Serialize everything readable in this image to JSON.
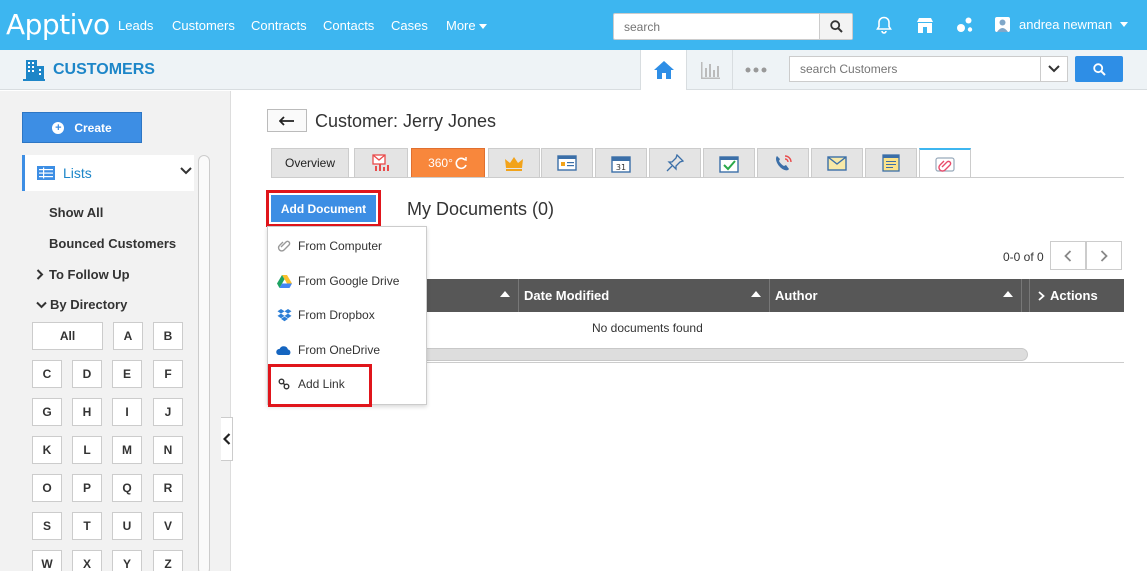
{
  "topnav": {
    "logo": "Apptivo",
    "items": [
      "Leads",
      "Customers",
      "Contracts",
      "Contacts",
      "Cases"
    ],
    "more_label": "More",
    "search_placeholder": "search",
    "user_name": "andrea newman"
  },
  "subheader": {
    "module_title": "CUSTOMERS",
    "search_placeholder": "search Customers"
  },
  "sidebar": {
    "create_label": "Create",
    "lists_label": "Lists",
    "items": [
      "Show All",
      "Bounced Customers"
    ],
    "follow_up_label": "To Follow Up",
    "by_directory_label": "By Directory",
    "alphabet": [
      "All",
      "A",
      "B",
      "C",
      "D",
      "E",
      "F",
      "G",
      "H",
      "I",
      "J",
      "K",
      "L",
      "M",
      "N",
      "O",
      "P",
      "Q",
      "R",
      "S",
      "T",
      "U",
      "V",
      "W",
      "X",
      "Y",
      "Z"
    ]
  },
  "main": {
    "title": "Customer: Jerry Jones",
    "tabs": {
      "overview": "Overview",
      "t360": "360°"
    },
    "add_document_label": "Add Document",
    "section_title": "My Documents (0)",
    "pager_text": "0-0 of 0",
    "table": {
      "columns": [
        "Date Modified",
        "Author",
        "Actions"
      ],
      "empty_text": "No documents found"
    },
    "menu": [
      "From Computer",
      "From Google Drive",
      "From Dropbox",
      "From OneDrive",
      "Add Link"
    ]
  },
  "colors": {
    "nav": "#3db6f0",
    "primary": "#3d8ee4",
    "highlight": "#e0151b",
    "tab360": "#f8873c"
  }
}
